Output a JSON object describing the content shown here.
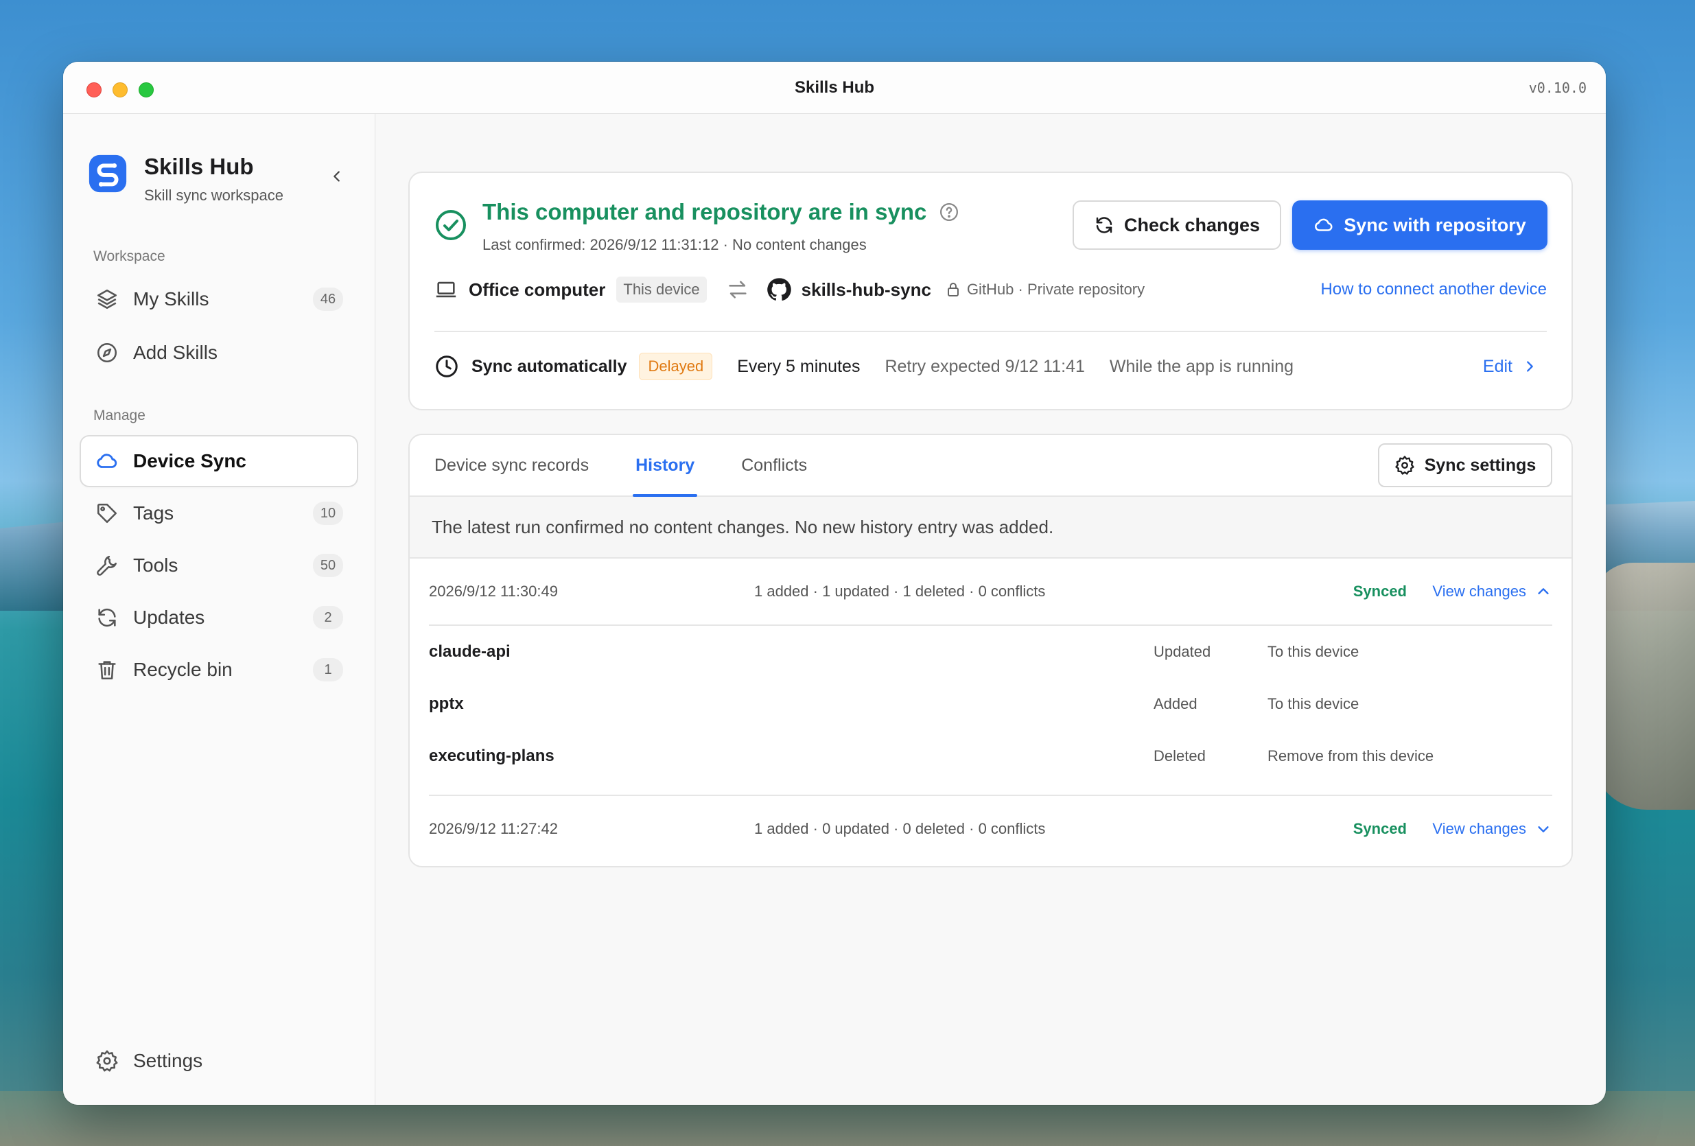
{
  "window": {
    "title": "Skills Hub",
    "version": "v0.10.0"
  },
  "brand": {
    "name": "Skills Hub",
    "subtitle": "Skill sync workspace"
  },
  "sidebar": {
    "workspace_label": "Workspace",
    "manage_label": "Manage",
    "workspace_items": [
      {
        "label": "My Skills",
        "icon": "layers-icon",
        "count": "46"
      },
      {
        "label": "Add Skills",
        "icon": "compass-icon"
      }
    ],
    "manage_items": [
      {
        "label": "Device Sync",
        "icon": "cloud-icon",
        "active": true
      },
      {
        "label": "Tags",
        "icon": "tag-icon",
        "count": "10"
      },
      {
        "label": "Tools",
        "icon": "wrench-icon",
        "count": "50"
      },
      {
        "label": "Updates",
        "icon": "refresh-icon",
        "count": "2"
      },
      {
        "label": "Recycle bin",
        "icon": "trash-icon",
        "count": "1"
      }
    ],
    "settings_label": "Settings"
  },
  "status": {
    "title": "This computer and repository are in sync",
    "subtitle": "Last confirmed: 2026/9/12 11:31:12 · No content changes",
    "check_label": "Check changes",
    "sync_label": "Sync with repository",
    "device_name": "Office computer",
    "device_tag": "This device",
    "repo_name": "skills-hub-sync",
    "repo_meta": "GitHub · Private repository",
    "connect_link": "How to connect another device",
    "auto_title": "Sync automatically",
    "auto_badge": "Delayed",
    "frequency": "Every 5 minutes",
    "retry": "Retry expected 9/12 11:41",
    "condition": "While the app is running",
    "edit_label": "Edit"
  },
  "tabs": {
    "items": [
      "Device sync records",
      "History",
      "Conflicts"
    ],
    "active": "History",
    "settings_label": "Sync settings"
  },
  "notice": "The latest run confirmed no content changes. No new history entry was added.",
  "runs": [
    {
      "time": "2026/9/12 11:30:49",
      "summary": "1 added · 1 updated · 1 deleted · 0 conflicts",
      "status": "Synced",
      "view_label": "View changes",
      "expanded": true,
      "changes": [
        {
          "name": "claude-api",
          "type": "Updated",
          "target": "To this device"
        },
        {
          "name": "pptx",
          "type": "Added",
          "target": "To this device"
        },
        {
          "name": "executing-plans",
          "type": "Deleted",
          "target": "Remove from this device"
        }
      ]
    },
    {
      "time": "2026/9/12 11:27:42",
      "summary": "1 added · 0 updated · 0 deleted · 0 conflicts",
      "status": "Synced",
      "view_label": "View changes",
      "expanded": false
    }
  ],
  "colors": {
    "accent": "#2a6ff0",
    "success": "#18905f",
    "warning": "#e07a12"
  }
}
